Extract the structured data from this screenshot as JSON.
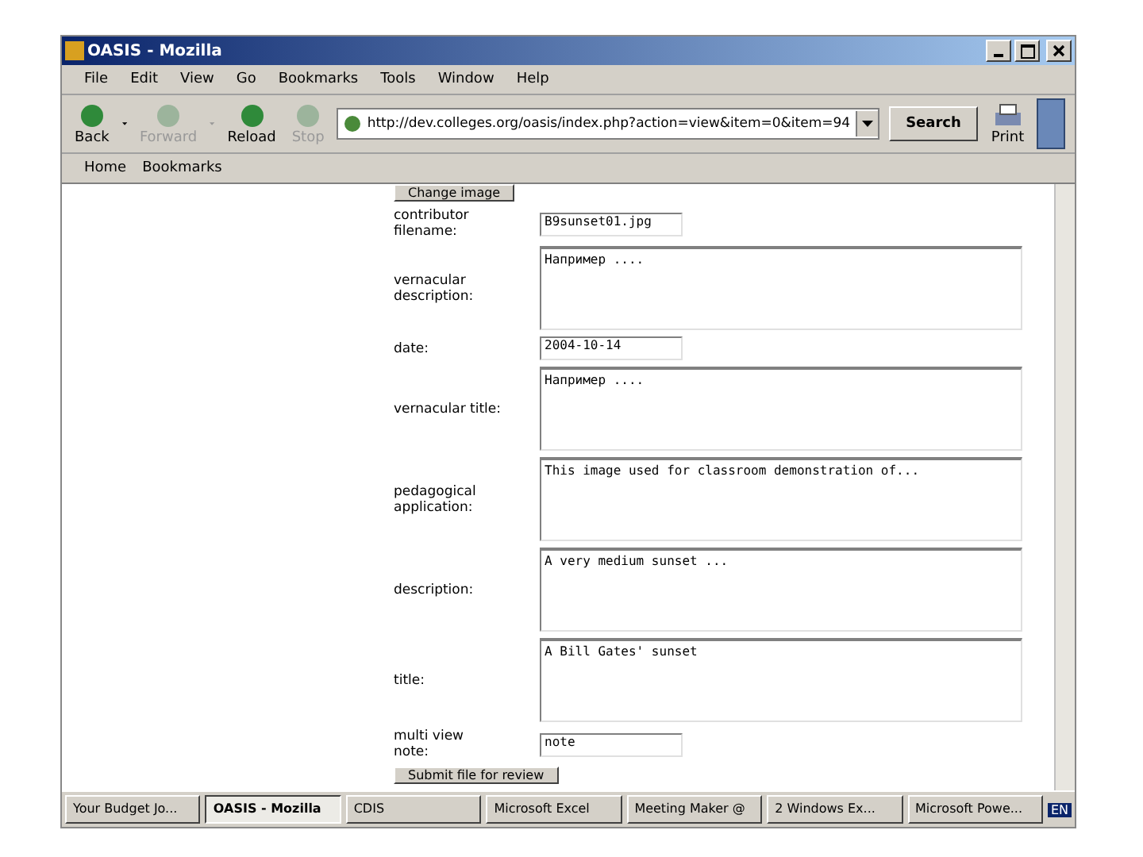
{
  "window": {
    "title": "OASIS - Mozilla"
  },
  "menu": [
    "File",
    "Edit",
    "View",
    "Go",
    "Bookmarks",
    "Tools",
    "Window",
    "Help"
  ],
  "toolbar": [
    {
      "label": "Back",
      "disabled": false,
      "dropdown": true
    },
    {
      "label": "Forward",
      "disabled": true,
      "dropdown": true
    },
    {
      "label": "Reload",
      "disabled": false,
      "dropdown": false
    },
    {
      "label": "Stop",
      "disabled": true,
      "dropdown": false
    }
  ],
  "address": {
    "value": "http://dev.colleges.org/oasis/index.php?action=view&item=0&item=94"
  },
  "search_button": "Search",
  "print_button": "Print",
  "personal_bar": [
    "Home",
    "Bookmarks"
  ],
  "change_image_button": "Change image",
  "fields": [
    {
      "label": "contributor filename:",
      "kind": "input",
      "value": "B9sunset01.jpg"
    },
    {
      "label": "vernacular description:",
      "kind": "textarea",
      "value": "Например ...."
    },
    {
      "label": "date:",
      "kind": "input",
      "value": "2004-10-14"
    },
    {
      "label": "vernacular title:",
      "kind": "textarea",
      "value": "Например ...."
    },
    {
      "label": "pedagogical application:",
      "kind": "textarea",
      "value": "This image used for classroom demonstration of..."
    },
    {
      "label": "description:",
      "kind": "textarea",
      "value": "A very medium sunset ..."
    },
    {
      "label": "title:",
      "kind": "textarea",
      "value": "A Bill Gates' sunset"
    },
    {
      "label": "multi view note:",
      "kind": "input",
      "value": "note"
    }
  ],
  "submit_button": "Submit file for review",
  "taskbar": [
    {
      "label": "Your Budget Jo...",
      "selected": false
    },
    {
      "label": "OASIS - Mozilla",
      "selected": true
    },
    {
      "label": "CDIS",
      "selected": false
    },
    {
      "label": "Microsoft Excel",
      "selected": false
    },
    {
      "label": "Meeting Maker @",
      "selected": false
    },
    {
      "label": "2 Windows Ex...",
      "selected": false
    },
    {
      "label": "Microsoft Powe...",
      "selected": false
    }
  ],
  "tray": {
    "language": "EN"
  }
}
